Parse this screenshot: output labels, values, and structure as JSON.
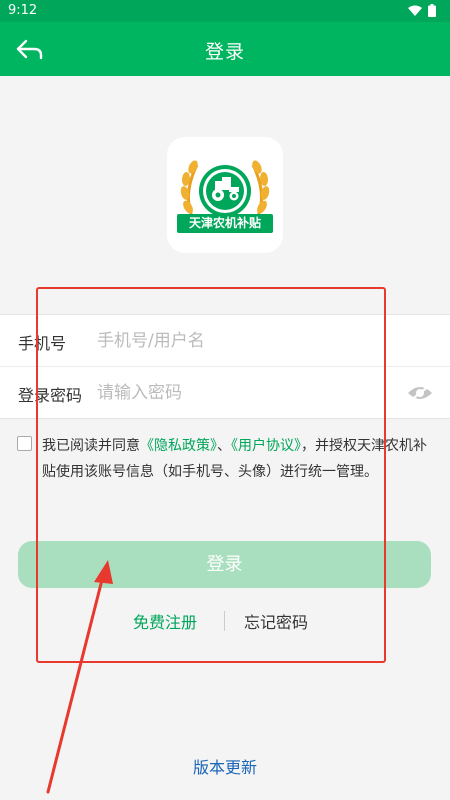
{
  "status_bar": {
    "time": "9:12",
    "icons": [
      "wifi-icon",
      "battery-icon"
    ]
  },
  "app_bar": {
    "title": "登录",
    "back_icon": "back-arrow-icon"
  },
  "logo": {
    "text": "天津农机补贴",
    "icon": "tractor-wheat-logo"
  },
  "form": {
    "phone_label": "手机号",
    "phone_placeholder": "手机号/用户名",
    "password_label": "登录密码",
    "password_placeholder": "请输入密码",
    "eye_icon": "eye-off-icon"
  },
  "agreement": {
    "checked": false,
    "prefix": "我已阅读并同意",
    "privacy_link": "《隐私政策》",
    "separator": "、",
    "user_link": "《用户协议》",
    "suffix": "，并授权天津农机补贴使用该账号信息（如手机号、头像）进行统一管理。"
  },
  "actions": {
    "login_label": "登录",
    "register_label": "免费注册",
    "forgot_label": "忘记密码",
    "version_label": "版本更新"
  },
  "colors": {
    "primary": "#00b55f",
    "button_disabled": "#a9dfbf",
    "link_blue": "#1a66b8",
    "annotation": "#e8392f"
  }
}
